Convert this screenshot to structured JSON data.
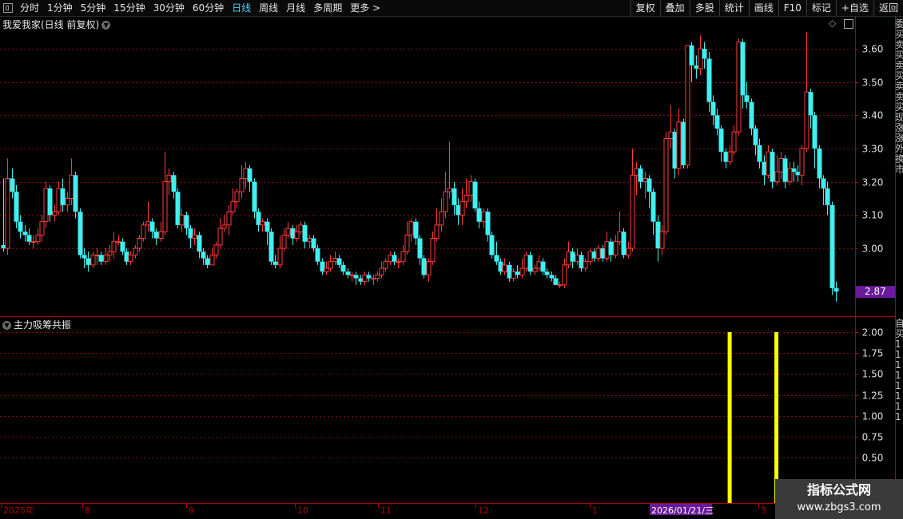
{
  "toolbar": {
    "periods": [
      "分时",
      "1分钟",
      "5分钟",
      "15分钟",
      "30分钟",
      "60分钟",
      "日线",
      "周线",
      "月线",
      "多周期",
      "更多 >"
    ],
    "active_period": "日线",
    "right_buttons": [
      "复权",
      "叠加",
      "多股",
      "统计",
      "画线",
      "F10",
      "标记",
      "+自选",
      "返回"
    ]
  },
  "main_panel": {
    "title": "我爱我家(日线 前复权)",
    "price_ticks": [
      "3.60",
      "3.50",
      "3.40",
      "3.30",
      "3.20",
      "3.10",
      "3.00"
    ],
    "last_price": "2.87"
  },
  "indicator_panel": {
    "title": "主力吸筹共振",
    "ticks": [
      "2.00",
      "1.75",
      "1.50",
      "1.25",
      "1.00",
      "0.75",
      "0.50"
    ]
  },
  "time_axis": {
    "labels": [
      "2025年",
      "8",
      "9",
      "10",
      "11",
      "12",
      "1",
      "3"
    ],
    "cursor_date": "2026/01/21/三"
  },
  "side_glyphs_top": [
    "委",
    "买",
    "卖",
    "买",
    "卖",
    "买",
    "卖",
    "卖",
    "买",
    "现",
    "涨",
    "涨",
    "外",
    "换",
    "市"
  ],
  "side_glyphs_bottom": [
    "自",
    "买",
    "1",
    "1",
    "1",
    "1",
    "1",
    "1",
    "1",
    "1"
  ],
  "watermark": {
    "line1": "指标公式网",
    "line2": "www.zbgs3.com"
  },
  "colors": {
    "up": "#ff3b3b",
    "down": "#3ff0f0",
    "signal": "#ffff00",
    "grid": "#7a0f0f",
    "border": "#b00000",
    "active": "#3fd2ff"
  },
  "chart_data": {
    "type": "candlestick",
    "price_range": [
      2.84,
      3.68
    ],
    "candles": [
      [
        3.01,
        3.0,
        3.21,
        2.99
      ],
      [
        3.0,
        3.21,
        3.27,
        2.98
      ],
      [
        3.21,
        3.17,
        3.24,
        3.15
      ],
      [
        3.17,
        3.08,
        3.19,
        3.06
      ],
      [
        3.08,
        3.05,
        3.1,
        3.03
      ],
      [
        3.05,
        3.04,
        3.07,
        3.02
      ],
      [
        3.04,
        3.02,
        3.06,
        3.01
      ],
      [
        3.02,
        3.02,
        3.04,
        3.0
      ],
      [
        3.02,
        3.04,
        3.06,
        3.01
      ],
      [
        3.04,
        3.08,
        3.1,
        3.02
      ],
      [
        3.08,
        3.18,
        3.2,
        3.06
      ],
      [
        3.18,
        3.1,
        3.19,
        3.08
      ],
      [
        3.1,
        3.11,
        3.13,
        3.08
      ],
      [
        3.11,
        3.18,
        3.2,
        3.1
      ],
      [
        3.18,
        3.13,
        3.21,
        3.11
      ],
      [
        3.13,
        3.15,
        3.17,
        3.11
      ],
      [
        3.15,
        3.22,
        3.27,
        3.13
      ],
      [
        3.22,
        3.11,
        3.23,
        3.09
      ],
      [
        3.11,
        2.98,
        3.12,
        2.97
      ],
      [
        2.98,
        2.97,
        3.0,
        2.94
      ],
      [
        2.97,
        2.95,
        2.99,
        2.93
      ],
      [
        2.95,
        2.98,
        2.99,
        2.94
      ],
      [
        2.98,
        2.98,
        3.0,
        2.95
      ],
      [
        2.98,
        2.96,
        2.99,
        2.95
      ],
      [
        2.96,
        2.98,
        3.0,
        2.95
      ],
      [
        2.98,
        2.99,
        3.01,
        2.96
      ],
      [
        2.99,
        3.02,
        3.05,
        2.97
      ],
      [
        3.02,
        3.02,
        3.04,
        3.01
      ],
      [
        3.02,
        2.99,
        3.03,
        2.98
      ],
      [
        2.99,
        2.96,
        3.0,
        2.95
      ],
      [
        2.96,
        2.98,
        2.99,
        2.95
      ],
      [
        2.98,
        3.0,
        3.01,
        2.97
      ],
      [
        3.0,
        3.03,
        3.04,
        2.99
      ],
      [
        3.03,
        3.07,
        3.08,
        3.02
      ],
      [
        3.07,
        3.08,
        3.14,
        3.05
      ],
      [
        3.08,
        3.05,
        3.09,
        3.03
      ],
      [
        3.05,
        3.03,
        3.06,
        3.01
      ],
      [
        3.03,
        3.05,
        3.08,
        3.02
      ],
      [
        3.05,
        3.2,
        3.29,
        3.04
      ],
      [
        3.2,
        3.22,
        3.24,
        3.16
      ],
      [
        3.22,
        3.17,
        3.23,
        3.15
      ],
      [
        3.17,
        3.07,
        3.18,
        3.06
      ],
      [
        3.07,
        3.1,
        3.12,
        3.05
      ],
      [
        3.1,
        3.06,
        3.11,
        3.04
      ],
      [
        3.06,
        3.03,
        3.07,
        3.0
      ],
      [
        3.03,
        3.04,
        3.06,
        3.01
      ],
      [
        3.04,
        2.99,
        3.05,
        2.97
      ],
      [
        2.99,
        2.97,
        3.0,
        2.95
      ],
      [
        2.97,
        2.95,
        2.98,
        2.94
      ],
      [
        2.95,
        2.98,
        3.0,
        2.95
      ],
      [
        2.98,
        3.01,
        3.02,
        2.97
      ],
      [
        3.01,
        3.06,
        3.09,
        3.0
      ],
      [
        3.06,
        3.07,
        3.1,
        3.05
      ],
      [
        3.07,
        3.11,
        3.13,
        3.04
      ],
      [
        3.11,
        3.14,
        3.18,
        3.1
      ],
      [
        3.14,
        3.17,
        3.18,
        3.12
      ],
      [
        3.17,
        3.21,
        3.25,
        3.15
      ],
      [
        3.21,
        3.24,
        3.26,
        3.18
      ],
      [
        3.24,
        3.2,
        3.25,
        3.17
      ],
      [
        3.2,
        3.11,
        3.21,
        3.09
      ],
      [
        3.11,
        3.07,
        3.12,
        3.05
      ],
      [
        3.07,
        3.08,
        3.09,
        3.05
      ],
      [
        3.08,
        3.05,
        3.09,
        3.01
      ],
      [
        3.05,
        2.96,
        3.06,
        2.95
      ],
      [
        2.96,
        2.95,
        2.98,
        2.94
      ],
      [
        2.95,
        3.0,
        3.04,
        2.94
      ],
      [
        3.0,
        3.04,
        3.06,
        2.99
      ],
      [
        3.04,
        3.06,
        3.08,
        3.03
      ],
      [
        3.06,
        3.03,
        3.07,
        3.01
      ],
      [
        3.03,
        3.05,
        3.07,
        3.02
      ],
      [
        3.05,
        3.07,
        3.08,
        3.04
      ],
      [
        3.07,
        3.02,
        3.08,
        3.0
      ],
      [
        3.02,
        3.03,
        3.04,
        3.0
      ],
      [
        3.03,
        3.0,
        3.04,
        2.99
      ],
      [
        3.0,
        2.96,
        3.01,
        2.95
      ],
      [
        2.96,
        2.93,
        2.97,
        2.92
      ],
      [
        2.93,
        2.94,
        2.96,
        2.92
      ],
      [
        2.94,
        2.96,
        2.98,
        2.93
      ],
      [
        2.96,
        2.97,
        2.99,
        2.95
      ],
      [
        2.97,
        2.95,
        2.98,
        2.94
      ],
      [
        2.95,
        2.93,
        2.96,
        2.92
      ],
      [
        2.93,
        2.92,
        2.94,
        2.91
      ],
      [
        2.92,
        2.92,
        2.93,
        2.9
      ],
      [
        2.92,
        2.91,
        2.93,
        2.89
      ],
      [
        2.91,
        2.9,
        2.92,
        2.89
      ],
      [
        2.9,
        2.92,
        2.93,
        2.89
      ],
      [
        2.92,
        2.91,
        2.93,
        2.9
      ],
      [
        2.91,
        2.91,
        2.92,
        2.89
      ],
      [
        2.91,
        2.92,
        2.93,
        2.9
      ],
      [
        2.92,
        2.94,
        2.96,
        2.91
      ],
      [
        2.94,
        2.96,
        2.97,
        2.93
      ],
      [
        2.96,
        2.98,
        2.99,
        2.95
      ],
      [
        2.98,
        2.96,
        2.99,
        2.95
      ],
      [
        2.96,
        2.96,
        2.97,
        2.94
      ],
      [
        2.96,
        2.99,
        3.01,
        2.95
      ],
      [
        2.99,
        3.04,
        3.08,
        2.98
      ],
      [
        3.04,
        3.08,
        3.09,
        3.02
      ],
      [
        3.08,
        3.03,
        3.09,
        3.01
      ],
      [
        3.03,
        2.97,
        3.04,
        2.95
      ],
      [
        2.97,
        2.92,
        2.98,
        2.91
      ],
      [
        2.92,
        2.96,
        2.97,
        2.9
      ],
      [
        2.96,
        3.03,
        3.05,
        2.95
      ],
      [
        3.03,
        3.07,
        3.12,
        3.02
      ],
      [
        3.07,
        3.11,
        3.15,
        3.05
      ],
      [
        3.11,
        3.17,
        3.23,
        3.09
      ],
      [
        3.17,
        3.18,
        3.32,
        3.15
      ],
      [
        3.18,
        3.13,
        3.2,
        3.1
      ],
      [
        3.13,
        3.1,
        3.15,
        3.07
      ],
      [
        3.1,
        3.14,
        3.18,
        3.07
      ],
      [
        3.14,
        3.16,
        3.21,
        3.12
      ],
      [
        3.16,
        3.2,
        3.22,
        3.14
      ],
      [
        3.2,
        3.12,
        3.21,
        3.11
      ],
      [
        3.12,
        3.08,
        3.14,
        3.06
      ],
      [
        3.08,
        3.11,
        3.12,
        3.06
      ],
      [
        3.11,
        3.04,
        3.12,
        3.02
      ],
      [
        3.04,
        2.98,
        3.05,
        2.97
      ],
      [
        2.98,
        2.96,
        3.02,
        2.95
      ],
      [
        2.96,
        2.93,
        2.97,
        2.92
      ],
      [
        2.93,
        2.95,
        2.97,
        2.92
      ],
      [
        2.95,
        2.91,
        2.96,
        2.9
      ],
      [
        2.91,
        2.93,
        2.94,
        2.9
      ],
      [
        2.93,
        2.92,
        2.95,
        2.91
      ],
      [
        2.92,
        2.94,
        2.97,
        2.91
      ],
      [
        2.94,
        2.98,
        2.99,
        2.93
      ],
      [
        2.98,
        2.93,
        2.99,
        2.92
      ],
      [
        2.93,
        2.94,
        2.95,
        2.92
      ],
      [
        2.94,
        2.96,
        2.98,
        2.93
      ],
      [
        2.96,
        2.93,
        2.97,
        2.92
      ],
      [
        2.93,
        2.92,
        2.94,
        2.91
      ],
      [
        2.92,
        2.91,
        2.93,
        2.9
      ],
      [
        2.91,
        2.89,
        2.92,
        2.89
      ],
      [
        2.89,
        2.89,
        2.9,
        2.88
      ],
      [
        2.89,
        2.95,
        2.97,
        2.88
      ],
      [
        2.95,
        2.99,
        3.02,
        2.94
      ],
      [
        2.99,
        2.96,
        3.0,
        2.94
      ],
      [
        2.96,
        2.98,
        3.0,
        2.95
      ],
      [
        2.98,
        2.94,
        2.99,
        2.93
      ],
      [
        2.94,
        2.96,
        2.97,
        2.93
      ],
      [
        2.96,
        2.99,
        3.0,
        2.95
      ],
      [
        2.99,
        2.97,
        3.0,
        2.96
      ],
      [
        2.97,
        3.0,
        3.01,
        2.96
      ],
      [
        3.0,
        2.97,
        3.01,
        2.96
      ],
      [
        2.97,
        3.02,
        3.05,
        2.96
      ],
      [
        3.02,
        2.98,
        3.03,
        2.96
      ],
      [
        2.98,
        3.02,
        3.04,
        2.97
      ],
      [
        3.02,
        3.05,
        3.11,
        3.01
      ],
      [
        3.05,
        2.98,
        3.06,
        2.97
      ],
      [
        2.98,
        3.0,
        3.02,
        2.97
      ],
      [
        3.0,
        3.22,
        3.3,
        2.99
      ],
      [
        3.22,
        3.24,
        3.26,
        3.16
      ],
      [
        3.24,
        3.2,
        3.25,
        3.18
      ],
      [
        3.2,
        3.21,
        3.23,
        3.15
      ],
      [
        3.21,
        3.17,
        3.22,
        3.12
      ],
      [
        3.17,
        3.08,
        3.18,
        3.04
      ],
      [
        3.08,
        3.0,
        3.1,
        2.96
      ],
      [
        3.0,
        3.05,
        3.07,
        2.98
      ],
      [
        3.05,
        3.33,
        3.35,
        3.04
      ],
      [
        3.33,
        3.35,
        3.43,
        3.3
      ],
      [
        3.35,
        3.24,
        3.36,
        3.21
      ],
      [
        3.24,
        3.38,
        3.42,
        3.22
      ],
      [
        3.38,
        3.25,
        3.39,
        3.24
      ],
      [
        3.25,
        3.61,
        3.61,
        3.24
      ],
      [
        3.61,
        3.55,
        3.62,
        3.5
      ],
      [
        3.55,
        3.54,
        3.58,
        3.51
      ],
      [
        3.54,
        3.6,
        3.64,
        3.52
      ],
      [
        3.6,
        3.57,
        3.62,
        3.54
      ],
      [
        3.57,
        3.44,
        3.59,
        3.41
      ],
      [
        3.44,
        3.4,
        3.46,
        3.37
      ],
      [
        3.4,
        3.36,
        3.42,
        3.34
      ],
      [
        3.36,
        3.29,
        3.37,
        3.26
      ],
      [
        3.29,
        3.26,
        3.3,
        3.24
      ],
      [
        3.26,
        3.29,
        3.31,
        3.25
      ],
      [
        3.29,
        3.35,
        3.37,
        3.28
      ],
      [
        3.35,
        3.62,
        3.63,
        3.34
      ],
      [
        3.62,
        3.46,
        3.63,
        3.42
      ],
      [
        3.46,
        3.44,
        3.5,
        3.42
      ],
      [
        3.44,
        3.36,
        3.45,
        3.34
      ],
      [
        3.36,
        3.31,
        3.37,
        3.28
      ],
      [
        3.31,
        3.26,
        3.33,
        3.24
      ],
      [
        3.26,
        3.22,
        3.28,
        3.19
      ],
      [
        3.22,
        3.29,
        3.31,
        3.21
      ],
      [
        3.29,
        3.2,
        3.3,
        3.18
      ],
      [
        3.2,
        3.23,
        3.28,
        3.19
      ],
      [
        3.23,
        3.27,
        3.29,
        3.21
      ],
      [
        3.27,
        3.2,
        3.28,
        3.18
      ],
      [
        3.2,
        3.24,
        3.26,
        3.19
      ],
      [
        3.24,
        3.23,
        3.26,
        3.2
      ],
      [
        3.23,
        3.22,
        3.25,
        3.2
      ],
      [
        3.22,
        3.3,
        3.31,
        3.19
      ],
      [
        3.3,
        3.47,
        3.65,
        3.29
      ],
      [
        3.47,
        3.4,
        3.48,
        3.36
      ],
      [
        3.4,
        3.3,
        3.41,
        3.24
      ],
      [
        3.3,
        3.21,
        3.31,
        3.18
      ],
      [
        3.21,
        3.18,
        3.22,
        3.13
      ],
      [
        3.18,
        3.13,
        3.2,
        3.1
      ],
      [
        3.13,
        2.88,
        3.14,
        2.86
      ],
      [
        2.88,
        2.87,
        2.9,
        2.84
      ]
    ],
    "signal_bars": [
      {
        "candle_index": 171,
        "value": 2.0
      },
      {
        "candle_index": 182,
        "value": 2.0
      }
    ],
    "indicator_range": [
      0,
      2.0
    ]
  }
}
